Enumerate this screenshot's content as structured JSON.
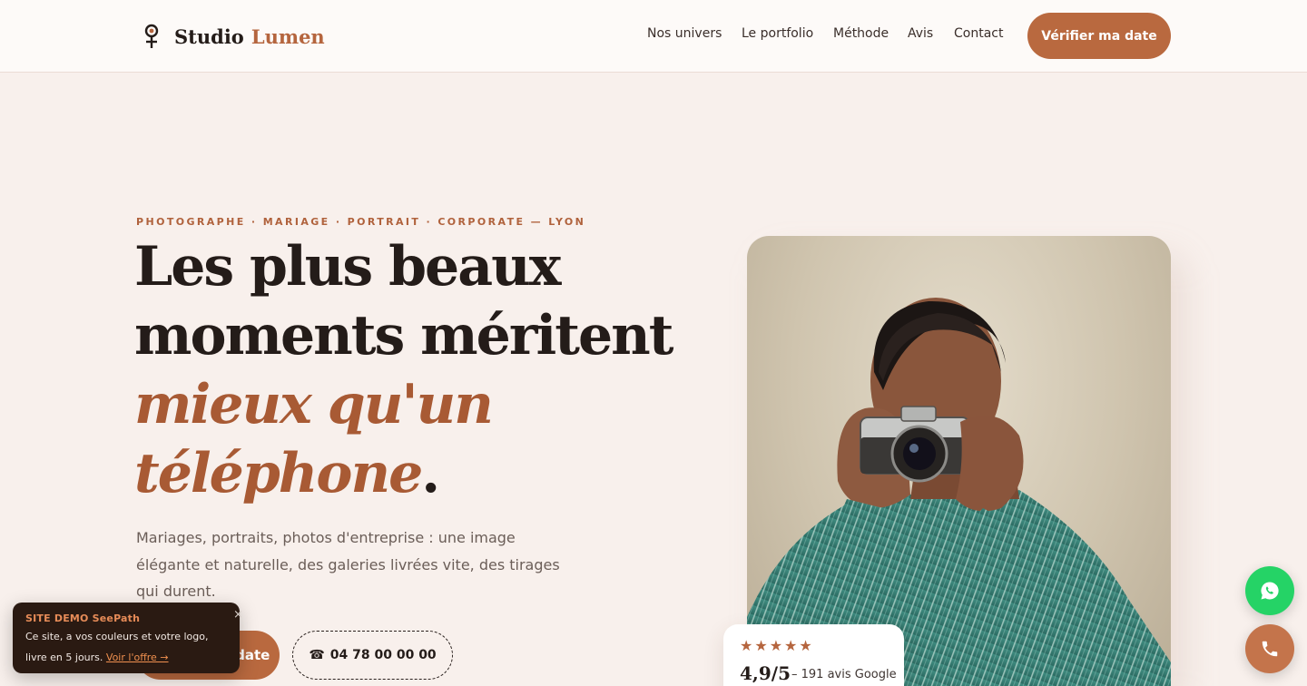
{
  "header": {
    "brand_name": "Studio",
    "brand_accent": "Lumen",
    "nav": [
      "Nos univers",
      "Le portfolio",
      "Méthode",
      "Avis",
      "Contact"
    ],
    "cta": "Vérifier ma date"
  },
  "hero": {
    "eyebrow": "PHOTOGRAPHE · MARIAGE · PORTRAIT · CORPORATE — LYON",
    "title_line1": "Les plus beaux",
    "title_line2": "moments méritent",
    "title_line3": "mieux qu'un",
    "title_line4": "téléphone",
    "title_dot": ".",
    "lead": "Mariages, portraits, photos d'entreprise : une image élégante et naturelle, des galeries livrées vite, des tirages qui durent.",
    "primary_button": "Vérifier ma date",
    "phone_icon": "☎",
    "phone": "04 78 00 00 00"
  },
  "rating": {
    "stars": "★★★★★",
    "score": "4,9/5",
    "reviews": "– 191 avis Google"
  },
  "toast": {
    "title": "SITE DEMO SeePath",
    "body": "Ce site, a vos couleurs et votre logo, livre en 5 jours.",
    "link": "Voir l'offre →",
    "close": "×"
  },
  "colors": {
    "accent": "#b9693f",
    "background": "#f8f0ec",
    "text": "#241c19",
    "whatsapp": "#25d366"
  },
  "icons": [
    "logo-icon",
    "whatsapp-icon",
    "phone-icon",
    "close-icon",
    "star-icon"
  ]
}
